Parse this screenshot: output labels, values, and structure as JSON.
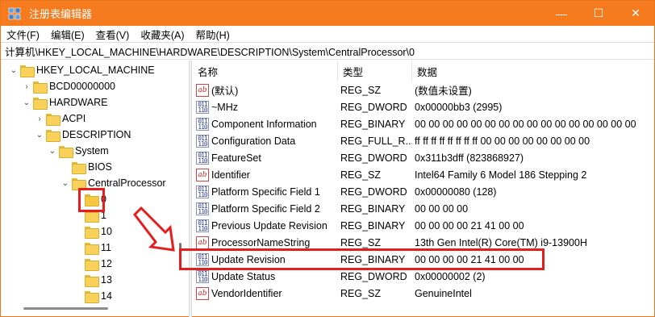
{
  "window": {
    "title": "注册表编辑器"
  },
  "titlebar": {
    "min_icon": "—",
    "max_icon": "☐",
    "close_icon": "✕"
  },
  "menu": [
    "文件(F)",
    "编辑(E)",
    "查看(V)",
    "收藏夹(A)",
    "帮助(H)"
  ],
  "address": "计算机\\HKEY_LOCAL_MACHINE\\HARDWARE\\DESCRIPTION\\System\\CentralProcessor\\0",
  "tree": [
    {
      "label": "HKEY_LOCAL_MACHINE",
      "arrow": "⌄",
      "selected": false
    },
    {
      "label": "BCD00000000",
      "arrow": "›",
      "selected": false
    },
    {
      "label": "HARDWARE",
      "arrow": "⌄",
      "selected": false
    },
    {
      "label": "ACPI",
      "arrow": "›",
      "selected": false
    },
    {
      "label": "DESCRIPTION",
      "arrow": "⌄",
      "selected": false
    },
    {
      "label": "System",
      "arrow": "⌄",
      "selected": false
    },
    {
      "label": "BIOS",
      "arrow": "",
      "selected": false
    },
    {
      "label": "CentralProcessor",
      "arrow": "⌄",
      "selected": false
    },
    {
      "label": "0",
      "arrow": "",
      "selected": true
    },
    {
      "label": "1",
      "arrow": "",
      "selected": false
    },
    {
      "label": "10",
      "arrow": "",
      "selected": false
    },
    {
      "label": "11",
      "arrow": "",
      "selected": false
    },
    {
      "label": "12",
      "arrow": "",
      "selected": false
    },
    {
      "label": "13",
      "arrow": "",
      "selected": false
    },
    {
      "label": "14",
      "arrow": "",
      "selected": false
    }
  ],
  "columns": {
    "name": "名称",
    "type": "类型",
    "data": "数据"
  },
  "values": [
    {
      "name": "(默认)",
      "type": "REG_SZ",
      "data": "(数值未设置)",
      "icon": "ab"
    },
    {
      "name": "~MHz",
      "type": "REG_DWORD",
      "data": "0x00000bb3 (2995)",
      "icon": "bin"
    },
    {
      "name": "Component Information",
      "type": "REG_BINARY",
      "data": "00 00 00 00 00 00 00 00 00 00 00 00 00 00 00 00",
      "icon": "bin"
    },
    {
      "name": "Configuration Data",
      "type": "REG_FULL_R...",
      "data": "ff ff ff ff ff ff ff ff 00 00 00 00 00 00 00 00",
      "icon": "bin"
    },
    {
      "name": "FeatureSet",
      "type": "REG_DWORD",
      "data": "0x311b3dff (823868927)",
      "icon": "bin"
    },
    {
      "name": "Identifier",
      "type": "REG_SZ",
      "data": "Intel64 Family 6 Model 186 Stepping 2",
      "icon": "ab"
    },
    {
      "name": "Platform Specific Field 1",
      "type": "REG_DWORD",
      "data": "0x00000080 (128)",
      "icon": "bin"
    },
    {
      "name": "Platform Specific Field 2",
      "type": "REG_BINARY",
      "data": "00 00 00 00",
      "icon": "bin"
    },
    {
      "name": "Previous Update Revision",
      "type": "REG_BINARY",
      "data": "00 00 00 00 21 41 00 00",
      "icon": "bin"
    },
    {
      "name": "ProcessorNameString",
      "type": "REG_SZ",
      "data": "13th Gen Intel(R) Core(TM) i9-13900H",
      "icon": "ab"
    },
    {
      "name": "Update Revision",
      "type": "REG_BINARY",
      "data": "00 00 00 00 21 41 00 00",
      "icon": "bin"
    },
    {
      "name": "Update Status",
      "type": "REG_DWORD",
      "data": "0x00000002 (2)",
      "icon": "bin"
    },
    {
      "name": "VendorIdentifier",
      "type": "REG_SZ",
      "data": "GenuineIntel",
      "icon": "ab"
    }
  ],
  "annotation": {
    "highlight_color": "#e41e1e"
  }
}
